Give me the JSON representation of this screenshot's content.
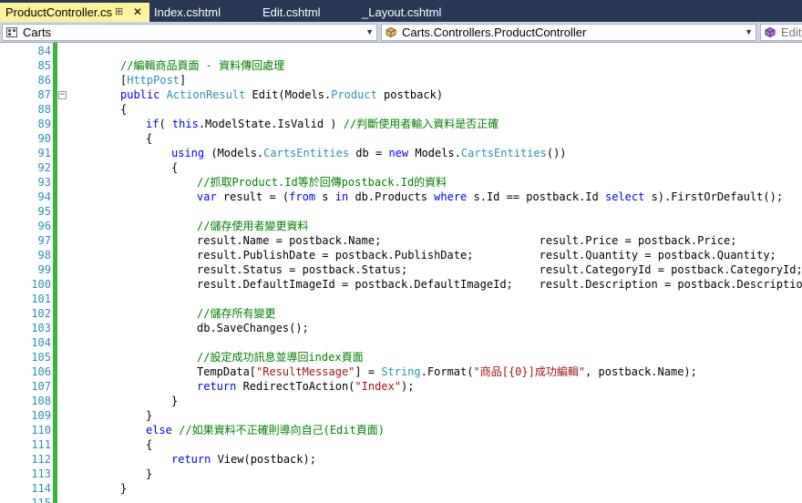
{
  "tabs": [
    {
      "label": "ProductController.cs",
      "active": true,
      "pin": "⊞",
      "close": "✕"
    },
    {
      "label": "Index.cshtml"
    },
    {
      "label": "Edit.cshtml"
    },
    {
      "label": "_Layout.cshtml"
    }
  ],
  "navbar": {
    "project": "Carts",
    "type": "Carts.Controllers.ProductController",
    "member": "Edit("
  },
  "colors": {
    "keyword": "#0000ff",
    "type": "#2b91af",
    "comment": "#008000",
    "string": "#a31515",
    "line_number": "#2b91af",
    "change_bar": "#3db23d",
    "tab_bar": "#293955",
    "active_tab": "#fff29d"
  },
  "lines": [
    {
      "n": "84",
      "indent": 0,
      "fold": false,
      "tokens": []
    },
    {
      "n": "85",
      "indent": 2,
      "fold": false,
      "tokens": [
        [
          "cm",
          "//編輯商品頁面 - 資料傳回處理"
        ]
      ]
    },
    {
      "n": "86",
      "indent": 2,
      "fold": false,
      "tokens": [
        [
          "tx",
          "["
        ],
        [
          "ty",
          "HttpPost"
        ],
        [
          "tx",
          "]"
        ]
      ]
    },
    {
      "n": "87",
      "indent": 2,
      "fold": true,
      "tokens": [
        [
          "kw",
          "public"
        ],
        [
          "tx",
          " "
        ],
        [
          "ty",
          "ActionResult"
        ],
        [
          "tx",
          " Edit(Models."
        ],
        [
          "ty",
          "Product"
        ],
        [
          "tx",
          " postback)"
        ]
      ]
    },
    {
      "n": "88",
      "indent": 2,
      "fold": false,
      "tokens": [
        [
          "tx",
          "{"
        ]
      ]
    },
    {
      "n": "89",
      "indent": 3,
      "fold": false,
      "tokens": [
        [
          "kw",
          "if"
        ],
        [
          "tx",
          "( "
        ],
        [
          "kw",
          "this"
        ],
        [
          "tx",
          ".ModelState.IsValid ) "
        ],
        [
          "cm",
          "//判斷使用者輸入資料是否正確"
        ]
      ]
    },
    {
      "n": "90",
      "indent": 3,
      "fold": false,
      "tokens": [
        [
          "tx",
          "{"
        ]
      ]
    },
    {
      "n": "91",
      "indent": 4,
      "fold": false,
      "tokens": [
        [
          "kw",
          "using"
        ],
        [
          "tx",
          " (Models."
        ],
        [
          "ty",
          "CartsEntities"
        ],
        [
          "tx",
          " db = "
        ],
        [
          "kw",
          "new"
        ],
        [
          "tx",
          " Models."
        ],
        [
          "ty",
          "CartsEntities"
        ],
        [
          "tx",
          "())"
        ]
      ]
    },
    {
      "n": "92",
      "indent": 4,
      "fold": false,
      "tokens": [
        [
          "tx",
          "{"
        ]
      ]
    },
    {
      "n": "93",
      "indent": 5,
      "fold": false,
      "tokens": [
        [
          "cm",
          "//抓取Product.Id等於回傳postback.Id的資料"
        ]
      ]
    },
    {
      "n": "94",
      "indent": 5,
      "fold": false,
      "tokens": [
        [
          "kw",
          "var"
        ],
        [
          "tx",
          " result = ("
        ],
        [
          "kw",
          "from"
        ],
        [
          "tx",
          " s "
        ],
        [
          "kw",
          "in"
        ],
        [
          "tx",
          " db.Products "
        ],
        [
          "kw",
          "where"
        ],
        [
          "tx",
          " s.Id == postback.Id "
        ],
        [
          "kw",
          "select"
        ],
        [
          "tx",
          " s).FirstOrDefault();"
        ]
      ]
    },
    {
      "n": "95",
      "indent": 0,
      "fold": false,
      "tokens": []
    },
    {
      "n": "96",
      "indent": 5,
      "fold": false,
      "tokens": [
        [
          "cm",
          "//儲存使用者變更資料"
        ]
      ]
    },
    {
      "n": "97",
      "indent": 5,
      "fold": false,
      "tokens": [
        [
          "tx",
          "result.Name = postback.Name;                        result.Price = postback.Price;"
        ]
      ]
    },
    {
      "n": "98",
      "indent": 5,
      "fold": false,
      "tokens": [
        [
          "tx",
          "result.PublishDate = postback.PublishDate;          result.Quantity = postback.Quantity;"
        ]
      ]
    },
    {
      "n": "99",
      "indent": 5,
      "fold": false,
      "tokens": [
        [
          "tx",
          "result.Status = postback.Status;                    result.CategoryId = postback.CategoryId;"
        ]
      ]
    },
    {
      "n": "100",
      "indent": 5,
      "fold": false,
      "tokens": [
        [
          "tx",
          "result.DefaultImageId = postback.DefaultImageId;    result.Description = postback.Description;"
        ]
      ]
    },
    {
      "n": "101",
      "indent": 0,
      "fold": false,
      "tokens": []
    },
    {
      "n": "102",
      "indent": 5,
      "fold": false,
      "tokens": [
        [
          "cm",
          "//儲存所有變更"
        ]
      ]
    },
    {
      "n": "103",
      "indent": 5,
      "fold": false,
      "tokens": [
        [
          "tx",
          "db.SaveChanges();"
        ]
      ]
    },
    {
      "n": "104",
      "indent": 0,
      "fold": false,
      "tokens": []
    },
    {
      "n": "105",
      "indent": 5,
      "fold": false,
      "tokens": [
        [
          "cm",
          "//設定成功訊息並導回index頁面"
        ]
      ]
    },
    {
      "n": "106",
      "indent": 5,
      "fold": false,
      "tokens": [
        [
          "tx",
          "TempData["
        ],
        [
          "st",
          "\"ResultMessage\""
        ],
        [
          "tx",
          "] = "
        ],
        [
          "ty",
          "String"
        ],
        [
          "tx",
          ".Format("
        ],
        [
          "st",
          "\"商品[{0}]成功編輯\""
        ],
        [
          "tx",
          ", postback.Name);"
        ]
      ]
    },
    {
      "n": "107",
      "indent": 5,
      "fold": false,
      "tokens": [
        [
          "kw",
          "return"
        ],
        [
          "tx",
          " RedirectToAction("
        ],
        [
          "st",
          "\"Index\""
        ],
        [
          "tx",
          ");"
        ]
      ]
    },
    {
      "n": "108",
      "indent": 4,
      "fold": false,
      "tokens": [
        [
          "tx",
          "}"
        ]
      ]
    },
    {
      "n": "109",
      "indent": 3,
      "fold": false,
      "tokens": [
        [
          "tx",
          "}"
        ]
      ]
    },
    {
      "n": "110",
      "indent": 3,
      "fold": false,
      "tokens": [
        [
          "kw",
          "else"
        ],
        [
          "tx",
          " "
        ],
        [
          "cm",
          "//如果資料不正確則導向自己(Edit頁面)"
        ]
      ]
    },
    {
      "n": "111",
      "indent": 3,
      "fold": false,
      "tokens": [
        [
          "tx",
          "{"
        ]
      ]
    },
    {
      "n": "112",
      "indent": 4,
      "fold": false,
      "tokens": [
        [
          "kw",
          "return"
        ],
        [
          "tx",
          " View(postback);"
        ]
      ]
    },
    {
      "n": "113",
      "indent": 3,
      "fold": false,
      "tokens": [
        [
          "tx",
          "}"
        ]
      ]
    },
    {
      "n": "114",
      "indent": 2,
      "fold": false,
      "tokens": [
        [
          "tx",
          "}"
        ]
      ]
    },
    {
      "n": "115",
      "indent": 0,
      "fold": false,
      "tokens": []
    }
  ]
}
